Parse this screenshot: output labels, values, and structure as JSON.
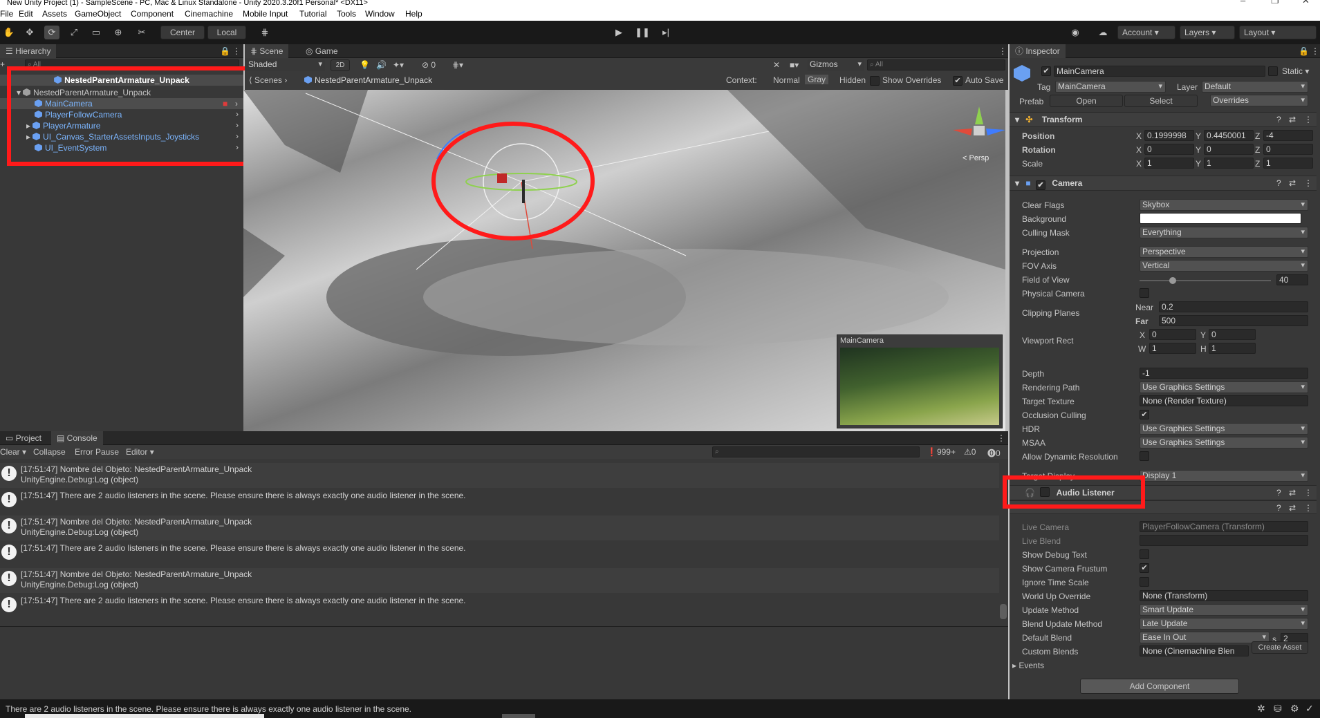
{
  "window": {
    "title": "New Unity Project (1) - SampleScene - PC, Mac & Linux Standalone - Unity 2020.3.20f1 Personal* <DX11>",
    "controls": [
      "–",
      "❐",
      "✕"
    ]
  },
  "menubar": [
    "File",
    "Edit",
    "Assets",
    "GameObject",
    "Component",
    "Cinemachine",
    "Mobile Input",
    "Tutorial",
    "Tools",
    "Window",
    "Help"
  ],
  "toolbar": {
    "center_label": "Center",
    "local_label": "Local",
    "account_label": "Account",
    "layers_label": "Layers",
    "layout_label": "Layout"
  },
  "hierarchy": {
    "tab": "Hierarchy",
    "search_placeholder": "All",
    "scene_root": "NestedParentArmature_Unpack",
    "root_object": "NestedParentArmature_Unpack",
    "children": [
      "MainCamera",
      "PlayerFollowCamera",
      "PlayerArmature",
      "UI_Canvas_StarterAssetsInputs_Joysticks",
      "UI_EventSystem"
    ]
  },
  "scene": {
    "tab_scene": "Scene",
    "tab_game": "Game",
    "shading": "Shaded",
    "mode_2d": "2D",
    "hidden_count": "0",
    "gizmos": "Gizmos",
    "search_placeholder": "All",
    "breadcrumb_root": "Scenes",
    "breadcrumb_prefab": "NestedParentArmature_Unpack",
    "context_label": "Context:",
    "context_normal": "Normal",
    "context_gray": "Gray",
    "context_hidden": "Hidden",
    "show_overrides": "Show Overrides",
    "auto_save": "Auto Save",
    "persp": "< Persp",
    "camera_preview_title": "MainCamera"
  },
  "console": {
    "tab_project": "Project",
    "tab_console": "Console",
    "clear": "Clear",
    "collapse": "Collapse",
    "error_pause": "Error Pause",
    "editor": "Editor",
    "log_count": "999+",
    "warn_count": "0",
    "error_count": "0",
    "rows": [
      {
        "line1": "[17:51:47] Nombre del Objeto: NestedParentArmature_Unpack",
        "line2": "UnityEngine.Debug:Log (object)"
      },
      {
        "line1": "[17:51:47] There are 2 audio listeners in the scene. Please ensure there is always exactly one audio listener in the scene.",
        "line2": ""
      },
      {
        "line1": "[17:51:47] Nombre del Objeto: NestedParentArmature_Unpack",
        "line2": "UnityEngine.Debug:Log (object)"
      },
      {
        "line1": "[17:51:47] There are 2 audio listeners in the scene. Please ensure there is always exactly one audio listener in the scene.",
        "line2": ""
      },
      {
        "line1": "[17:51:47] Nombre del Objeto: NestedParentArmature_Unpack",
        "line2": "UnityEngine.Debug:Log (object)"
      },
      {
        "line1": "[17:51:47] There are 2 audio listeners in the scene. Please ensure there is always exactly one audio listener in the scene.",
        "line2": ""
      }
    ]
  },
  "statusbar": {
    "message": "There are 2 audio listeners in the scene. Please ensure there is always exactly one audio listener in the scene."
  },
  "inspector": {
    "tab": "Inspector",
    "object_name": "MainCamera",
    "static_label": "Static",
    "tag_label": "Tag",
    "tag_value": "MainCamera",
    "layer_label": "Layer",
    "layer_value": "Default",
    "prefab_label": "Prefab",
    "open": "Open",
    "select": "Select",
    "overrides": "Overrides",
    "transform": {
      "title": "Transform",
      "position_label": "Position",
      "rotation_label": "Rotation",
      "scale_label": "Scale",
      "position": [
        "0.1999998",
        "0.4450001",
        "-4"
      ],
      "rotation": [
        "0",
        "0",
        "0"
      ],
      "scale": [
        "1",
        "1",
        "1"
      ]
    },
    "camera": {
      "title": "Camera",
      "fields": [
        {
          "label": "Clear Flags",
          "value": "Skybox",
          "kind": "drop"
        },
        {
          "label": "Background",
          "value": "",
          "kind": "color"
        },
        {
          "label": "Culling Mask",
          "value": "Everything",
          "kind": "drop"
        },
        {
          "label": "Projection",
          "value": "Perspective",
          "kind": "drop"
        },
        {
          "label": "FOV Axis",
          "value": "Vertical",
          "kind": "drop"
        },
        {
          "label": "Field of View",
          "value": "40",
          "kind": "slider"
        },
        {
          "label": "Physical Camera",
          "value": "",
          "kind": "check"
        },
        {
          "label": "Clipping Planes",
          "value": "",
          "kind": "none"
        },
        {
          "label": "Viewport Rect",
          "value": "",
          "kind": "none"
        },
        {
          "label": "Depth",
          "value": "-1",
          "kind": "field"
        },
        {
          "label": "Rendering Path",
          "value": "Use Graphics Settings",
          "kind": "drop"
        },
        {
          "label": "Target Texture",
          "value": "None (Render Texture)",
          "kind": "field"
        },
        {
          "label": "Occlusion Culling",
          "value": "✔",
          "kind": "check"
        },
        {
          "label": "HDR",
          "value": "Use Graphics Settings",
          "kind": "drop"
        },
        {
          "label": "MSAA",
          "value": "Use Graphics Settings",
          "kind": "drop"
        },
        {
          "label": "Allow Dynamic Resolution",
          "value": "",
          "kind": "check"
        },
        {
          "label": "Target Display",
          "value": "Display 1",
          "kind": "drop"
        }
      ],
      "near_label": "Near",
      "near": "0.2",
      "far_label": "Far",
      "far": "500",
      "vp_x": "0",
      "vp_y": "0",
      "vp_w": "1",
      "vp_h": "1",
      "fov_fraction": 0.25
    },
    "audio_listener": {
      "title": "Audio Listener"
    },
    "brain": {
      "fields": [
        {
          "label": "Live Camera",
          "value": "PlayerFollowCamera (Transform)",
          "kind": "field",
          "dim": true
        },
        {
          "label": "Live Blend",
          "value": "",
          "kind": "field",
          "dim": true
        },
        {
          "label": "Show Debug Text",
          "value": "",
          "kind": "check"
        },
        {
          "label": "Show Camera Frustum",
          "value": "✔",
          "kind": "check"
        },
        {
          "label": "Ignore Time Scale",
          "value": "",
          "kind": "check"
        },
        {
          "label": "World Up Override",
          "value": "None (Transform)",
          "kind": "field"
        },
        {
          "label": "Update Method",
          "value": "Smart Update",
          "kind": "drop"
        },
        {
          "label": "Blend Update Method",
          "value": "Late Update",
          "kind": "drop"
        },
        {
          "label": "Default Blend",
          "value": "Ease In Out",
          "kind": "drop"
        },
        {
          "label": "Custom Blends",
          "value": "None (Cinemachine Blen",
          "kind": "field"
        }
      ],
      "blend_s_label": "s",
      "blend_s_value": "2",
      "create_asset": "Create Asset",
      "events": "Events"
    },
    "add_component": "Add Component"
  },
  "colors": {
    "highlight_red": "#ff1a1a",
    "selection_blue": "#7cb6ff",
    "panel_bg": "#383838",
    "toolbar_bg": "#191919"
  }
}
